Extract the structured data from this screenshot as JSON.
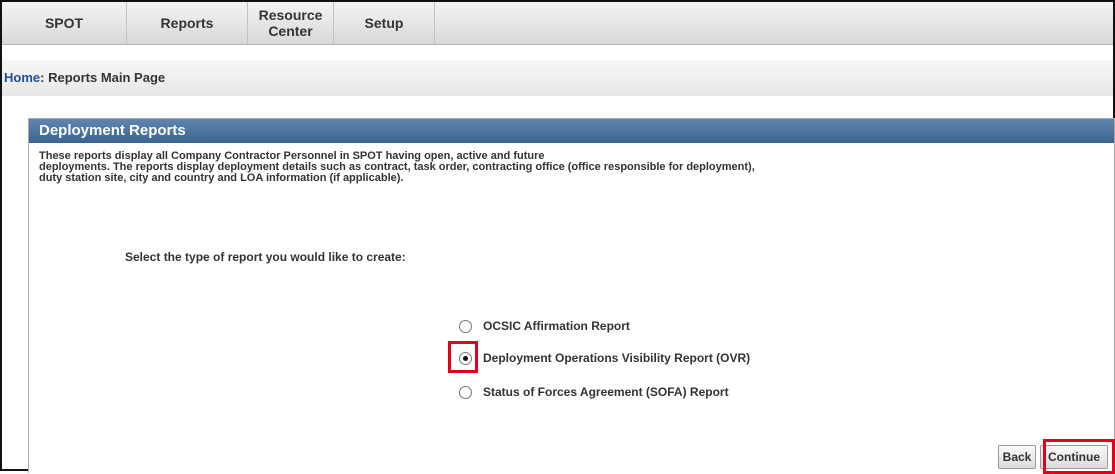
{
  "nav": {
    "items": [
      {
        "label": "SPOT"
      },
      {
        "label": "Reports"
      },
      {
        "label": "Resource Center"
      },
      {
        "label": "Setup"
      }
    ]
  },
  "breadcrumb": {
    "home": "Home",
    "separator": ":",
    "current": "Reports Main Page"
  },
  "panel": {
    "title": "Deployment Reports",
    "description_lines": [
      "These reports display all Company Contractor Personnel in SPOT having open, active and future",
      "deployments. The reports display deployment details such as contract, task order, contracting office (office responsible for deployment),",
      "duty station site, city and country and LOA information (if applicable)."
    ],
    "prompt": "Select the type of report you would like to create:",
    "options": [
      {
        "label": "OCSIC Affirmation Report",
        "selected": false
      },
      {
        "label": "Deployment Operations Visibility Report (OVR)",
        "selected": true
      },
      {
        "label": "Status of Forces Agreement (SOFA) Report",
        "selected": false
      }
    ]
  },
  "buttons": {
    "back": "Back",
    "continue": "Continue"
  },
  "colors": {
    "header_blue": "#3b638f",
    "link_blue": "#1f4e91",
    "highlight_red": "#e3001b"
  }
}
